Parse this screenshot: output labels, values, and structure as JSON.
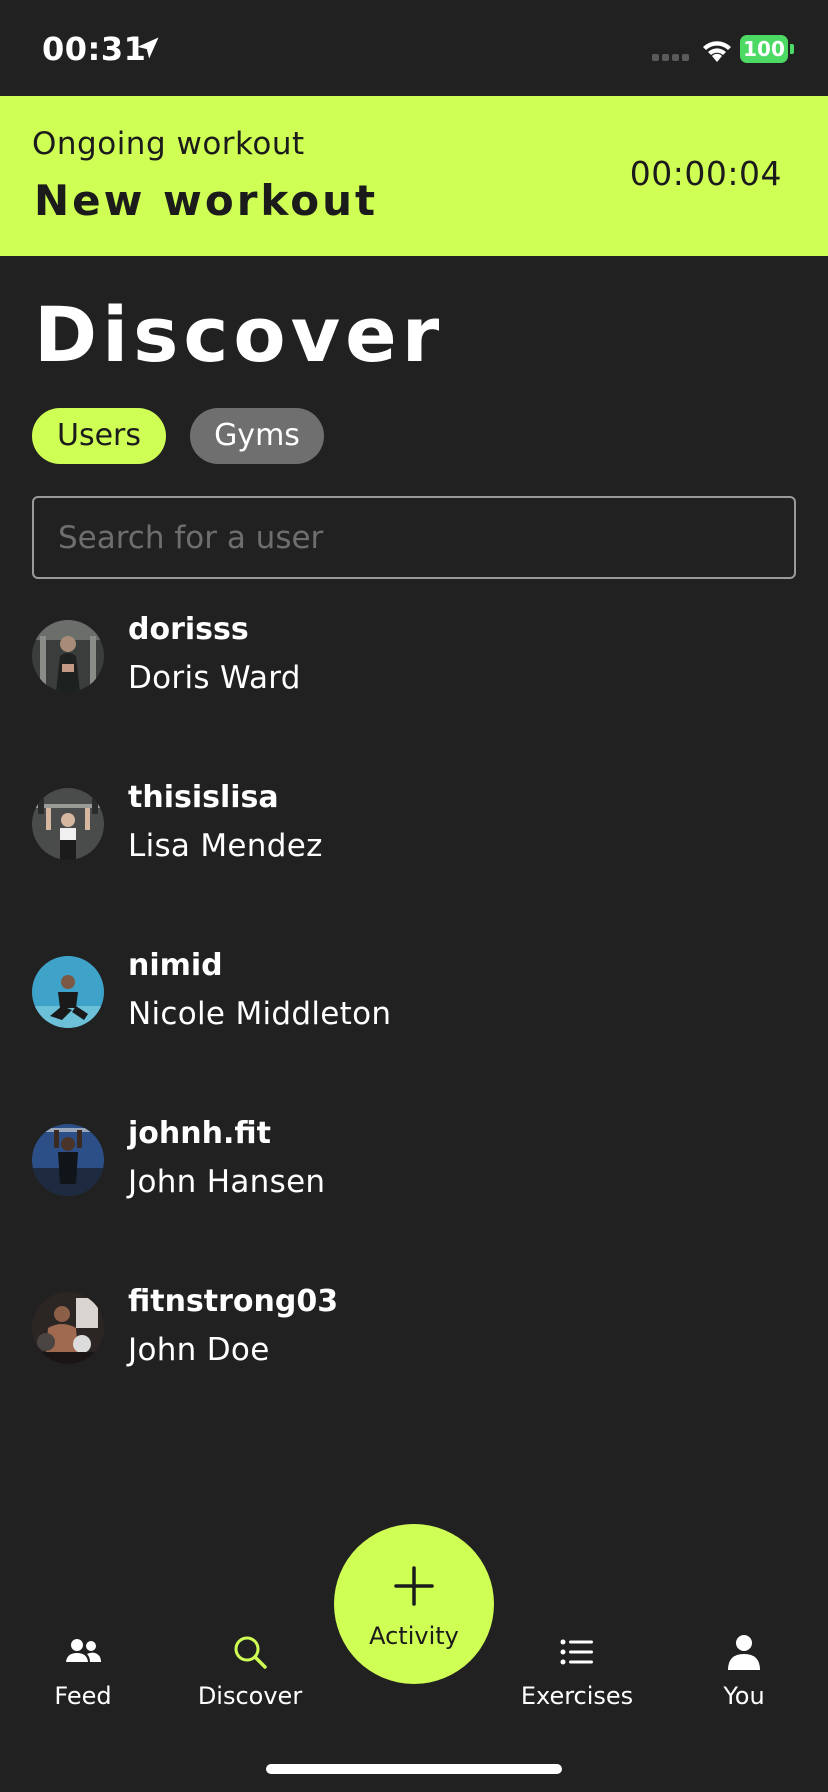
{
  "status_bar": {
    "time": "00:31",
    "battery": "100",
    "battery_color": "#4cd964"
  },
  "banner": {
    "label": "Ongoing workout",
    "title": "New workout",
    "timer": "00:00:04",
    "color": "#cffe55"
  },
  "page": {
    "title": "Discover"
  },
  "tabs": [
    {
      "label": "Users",
      "active": true
    },
    {
      "label": "Gyms",
      "active": false
    }
  ],
  "search": {
    "placeholder": "Search for a user",
    "value": ""
  },
  "users": [
    {
      "username": "dorisss",
      "name": "Doris Ward"
    },
    {
      "username": "thisislisa",
      "name": "Lisa Mendez"
    },
    {
      "username": "nimid",
      "name": "Nicole Middleton"
    },
    {
      "username": "johnh.fit",
      "name": "John Hansen"
    },
    {
      "username": "fitnstrong03",
      "name": "John Doe"
    }
  ],
  "nav": {
    "feed": "Feed",
    "discover": "Discover",
    "activity": "Activity",
    "exercises": "Exercises",
    "you": "You",
    "active_item": "discover",
    "active_color": "#cffe55"
  },
  "icons": [
    "location-arrow-icon",
    "signal-icon",
    "wifi-icon",
    "people-icon",
    "search-icon",
    "plus-icon",
    "list-icon",
    "person-icon"
  ]
}
